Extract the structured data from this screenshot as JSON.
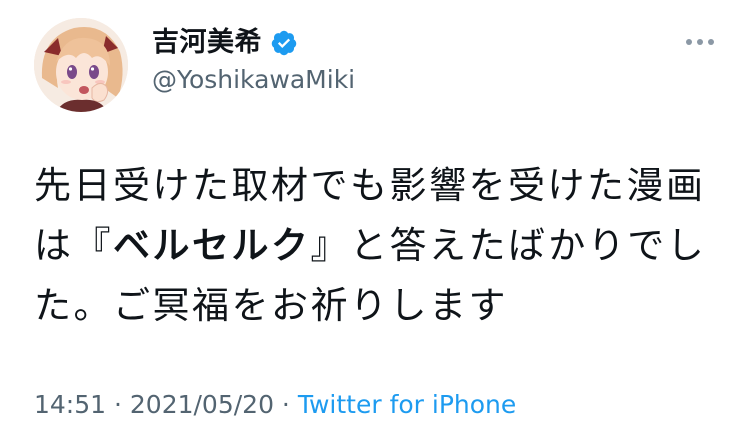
{
  "user": {
    "display_name": "吉河美希",
    "handle": "@YoshikawaMiki",
    "verified": true
  },
  "tweet": {
    "text_before": "先日受けた取材でも影響を受けた漫画は『",
    "text_bold": "ベルセルク",
    "text_after": "』と答えたばかりでした。ご冥福をお祈りします"
  },
  "meta": {
    "time": "14:51",
    "separator_1": " · ",
    "date": "2021/05/20",
    "separator_2": " · ",
    "source": "Twitter for iPhone"
  },
  "icons": {
    "verified": "verified-badge-icon",
    "more": "more-options-icon",
    "avatar": "anime-girl-avatar"
  },
  "colors": {
    "text_primary": "#0f1419",
    "text_secondary": "#536471",
    "accent": "#1d9bf0",
    "background": "#ffffff"
  }
}
